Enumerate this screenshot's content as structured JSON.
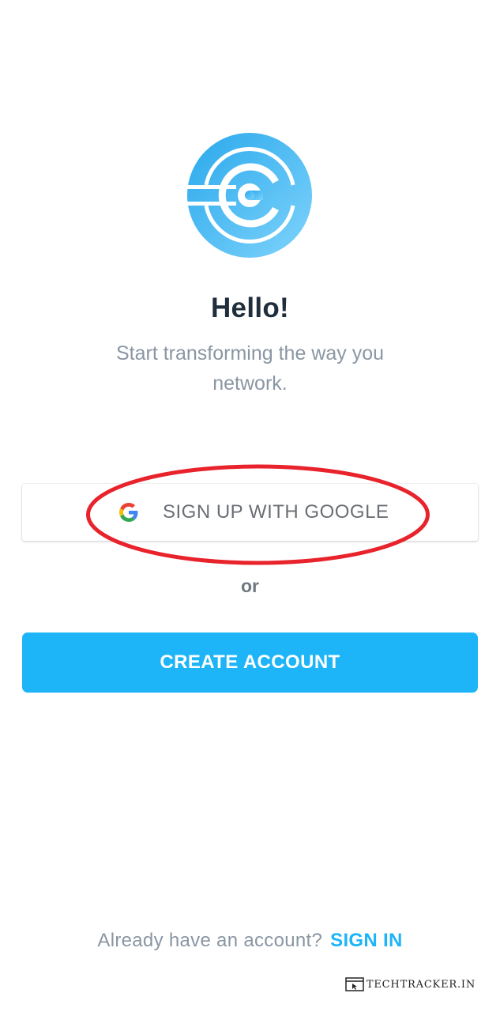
{
  "brand": {
    "logo_icon": "circular-c-logo-icon",
    "accent_color": "#1eb5f8"
  },
  "header": {
    "title": "Hello!",
    "subtitle": "Start transforming the way you network."
  },
  "google_signup": {
    "label": "SIGN UP WITH GOOGLE",
    "icon": "google-g-icon"
  },
  "divider": {
    "text": "or"
  },
  "create_account": {
    "label": "CREATE ACCOUNT"
  },
  "footer": {
    "prompt": "Already have an account?",
    "signin_label": "SIGN IN"
  },
  "watermark": {
    "text": "TECHTRACKER.IN"
  },
  "annotation": {
    "highlight_color": "#e8232c"
  }
}
